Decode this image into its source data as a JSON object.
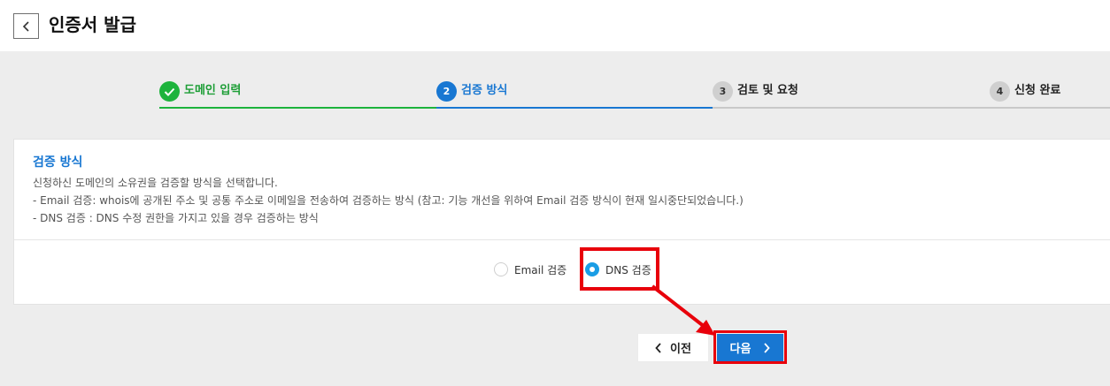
{
  "header": {
    "title": "인증서 발급",
    "back_icon": "chevron-left-icon"
  },
  "stepper": {
    "steps": [
      {
        "number": "1",
        "label": "도메인 입력",
        "status": "completed"
      },
      {
        "number": "2",
        "label": "검증 방식",
        "status": "active"
      },
      {
        "number": "3",
        "label": "검토 및 요청",
        "status": "pending"
      },
      {
        "number": "4",
        "label": "신청 완료",
        "status": "pending"
      }
    ]
  },
  "card": {
    "title": "검증 방식",
    "descriptions": [
      "신청하신 도메인의 소유권을 검증할 방식을 선택합니다.",
      "- Email 검증: whois에 공개된 주소 및 공통 주소로 이메일을 전송하여 검증하는 방식 (참고: 기능 개선을 위하여 Email 검증 방식이 현재 일시중단되었습니다.)",
      "- DNS 검증 : DNS 수정 권한을 가지고 있을 경우 검증하는 방식"
    ],
    "options": [
      {
        "label": "Email 검증",
        "selected": false
      },
      {
        "label": "DNS 검증",
        "selected": true
      }
    ]
  },
  "buttons": {
    "prev_label": "이전",
    "next_label": "다음"
  },
  "colors": {
    "completed": "#1db33c",
    "active": "#1877d2",
    "highlight": "#e8000b",
    "radio_selected": "#1a9de5"
  }
}
